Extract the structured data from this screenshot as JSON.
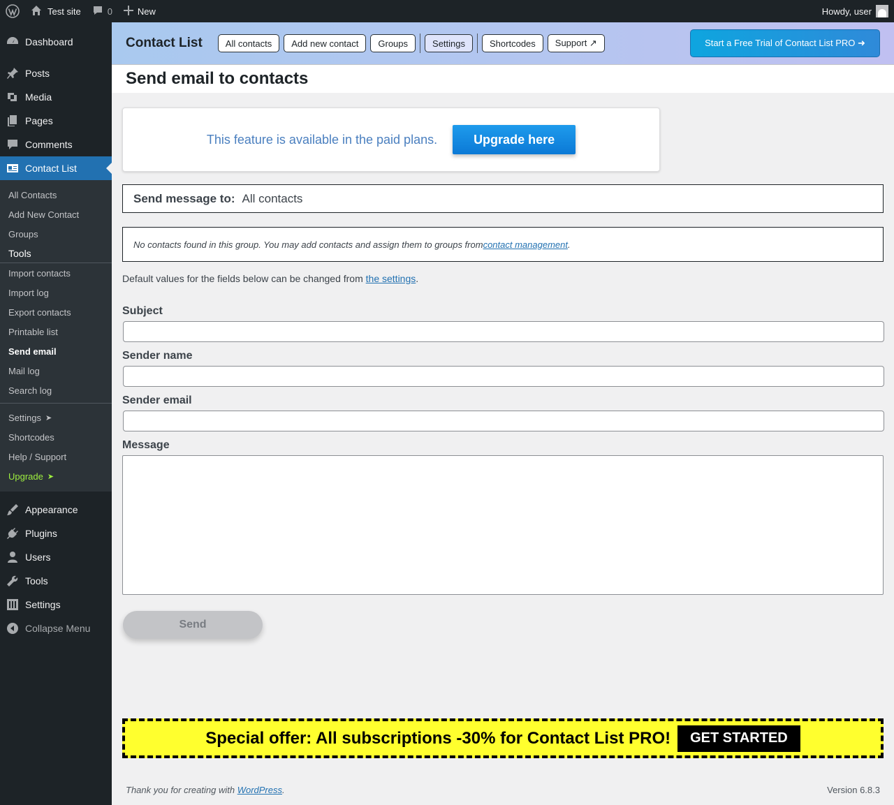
{
  "adminbar": {
    "site_name": "Test site",
    "comments_count": "0",
    "new_label": "New",
    "howdy": "Howdy, user"
  },
  "sidebar": {
    "top_items": {
      "dashboard": "Dashboard",
      "posts": "Posts",
      "media": "Media",
      "pages": "Pages",
      "comments": "Comments",
      "contact_list": "Contact List",
      "appearance": "Appearance",
      "plugins": "Plugins",
      "users": "Users",
      "tools": "Tools",
      "settings": "Settings",
      "collapse": "Collapse Menu"
    },
    "submenu": {
      "all_contacts": "All Contacts",
      "add_new": "Add New Contact",
      "groups": "Groups",
      "tools_head": "Tools",
      "import": "Import contacts",
      "import_log": "Import log",
      "export": "Export contacts",
      "printable": "Printable list",
      "send_email": "Send email",
      "mail_log": "Mail log",
      "search_log": "Search log",
      "settings": "Settings",
      "shortcodes": "Shortcodes",
      "help": "Help / Support",
      "upgrade": "Upgrade",
      "arrow": "➤"
    }
  },
  "plugin_header": {
    "title": "Contact List",
    "buttons": {
      "all": "All contacts",
      "add": "Add new contact",
      "groups": "Groups",
      "settings": "Settings",
      "shortcodes": "Shortcodes",
      "support": "Support ↗"
    },
    "trial": "Start a Free Trial of Contact List PRO ➜"
  },
  "page": {
    "title": "Send email to contacts",
    "notice_text": "This feature is available in the paid plans.",
    "upgrade_button": "Upgrade here",
    "send_to_label": "Send message to:",
    "send_to_value": "All contacts",
    "no_contacts_text": "No contacts found in this group. You may add contacts and assign them to groups from ",
    "no_contacts_link": "contact management",
    "period": ".",
    "defaults_text": "Default values for the fields below can be changed from ",
    "defaults_link": "the settings",
    "fields": {
      "subject": "Subject",
      "sender_name": "Sender name",
      "sender_email": "Sender email",
      "message": "Message"
    },
    "send_button": "Send"
  },
  "offer": {
    "text": "Special offer: All subscriptions -30% for Contact List PRO!",
    "button": "GET STARTED"
  },
  "footer": {
    "thanks": "Thank you for creating with ",
    "wp_link": "WordPress",
    "version": "Version 6.8.3"
  },
  "colors": {
    "accent": "#2271b1",
    "sidebar_bg": "#1d2327",
    "offer_bg": "#ffff2e",
    "upgrade_green": "#9eef3f"
  }
}
